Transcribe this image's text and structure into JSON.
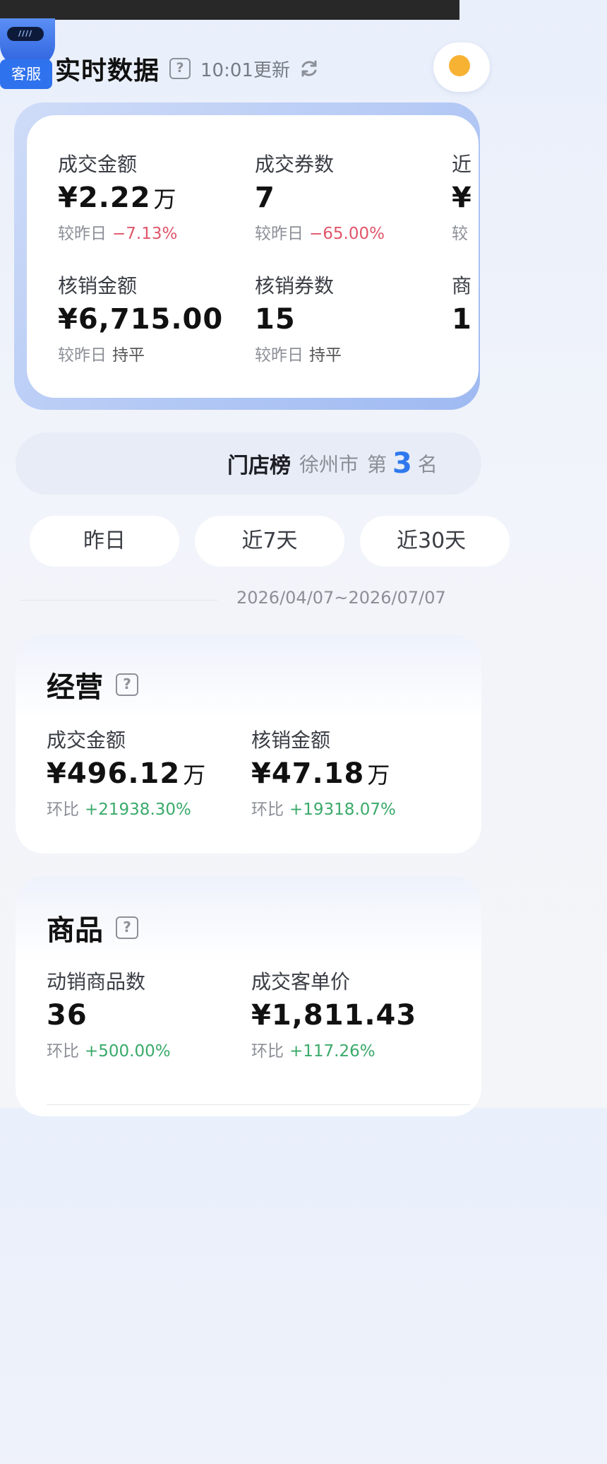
{
  "support": {
    "visor": "////",
    "label": "客服"
  },
  "header": {
    "title": "实时数据",
    "help": "?",
    "update_time": "10:01更新"
  },
  "realtime": {
    "metrics": [
      {
        "label": "成交金额",
        "value": "¥2.22",
        "unit": "万",
        "cmp_label": "较昨日",
        "cmp_value": "−7.13%",
        "trend": "neg"
      },
      {
        "label": "成交券数",
        "value": "7",
        "unit": "",
        "cmp_label": "较昨日",
        "cmp_value": "−65.00%",
        "trend": "neg"
      },
      {
        "label": "核销金额",
        "value": "¥6,715.00",
        "unit": "",
        "cmp_label": "较昨日",
        "cmp_value": "持平",
        "trend": "flat"
      },
      {
        "label": "核销券数",
        "value": "15",
        "unit": "",
        "cmp_label": "较昨日",
        "cmp_value": "持平",
        "trend": "flat"
      }
    ],
    "clipped": {
      "top_label_char": "近",
      "top_value_char": "¥",
      "top_cmp_char": "较",
      "bottom_label_char": "商",
      "bottom_value_char": "1"
    }
  },
  "rank": {
    "title": "门店榜",
    "city": "徐州市",
    "prefix": "第",
    "number": "3",
    "suffix": "名"
  },
  "periods": {
    "tabs": [
      "昨日",
      "近7天",
      "近30天"
    ],
    "date_range": "2026/04/07~2026/07/07"
  },
  "business": {
    "title": "经营",
    "help": "?",
    "metrics": [
      {
        "label": "成交金额",
        "value": "¥496.12",
        "unit": "万",
        "cmp_label": "环比",
        "cmp_value": "+21938.30%"
      },
      {
        "label": "核销金额",
        "value": "¥47.18",
        "unit": "万",
        "cmp_label": "环比",
        "cmp_value": "+19318.07%"
      }
    ]
  },
  "goods": {
    "title": "商品",
    "help": "?",
    "metrics": [
      {
        "label": "动销商品数",
        "value": "36",
        "unit": "",
        "cmp_label": "环比",
        "cmp_value": "+500.00%"
      },
      {
        "label": "成交客单价",
        "value": "¥1,811.43",
        "unit": "",
        "cmp_label": "环比",
        "cmp_value": "+117.26%"
      }
    ]
  },
  "colors": {
    "accent_blue": "#2f78ee",
    "negative": "#e0566a",
    "positive": "#3aaa6a"
  }
}
